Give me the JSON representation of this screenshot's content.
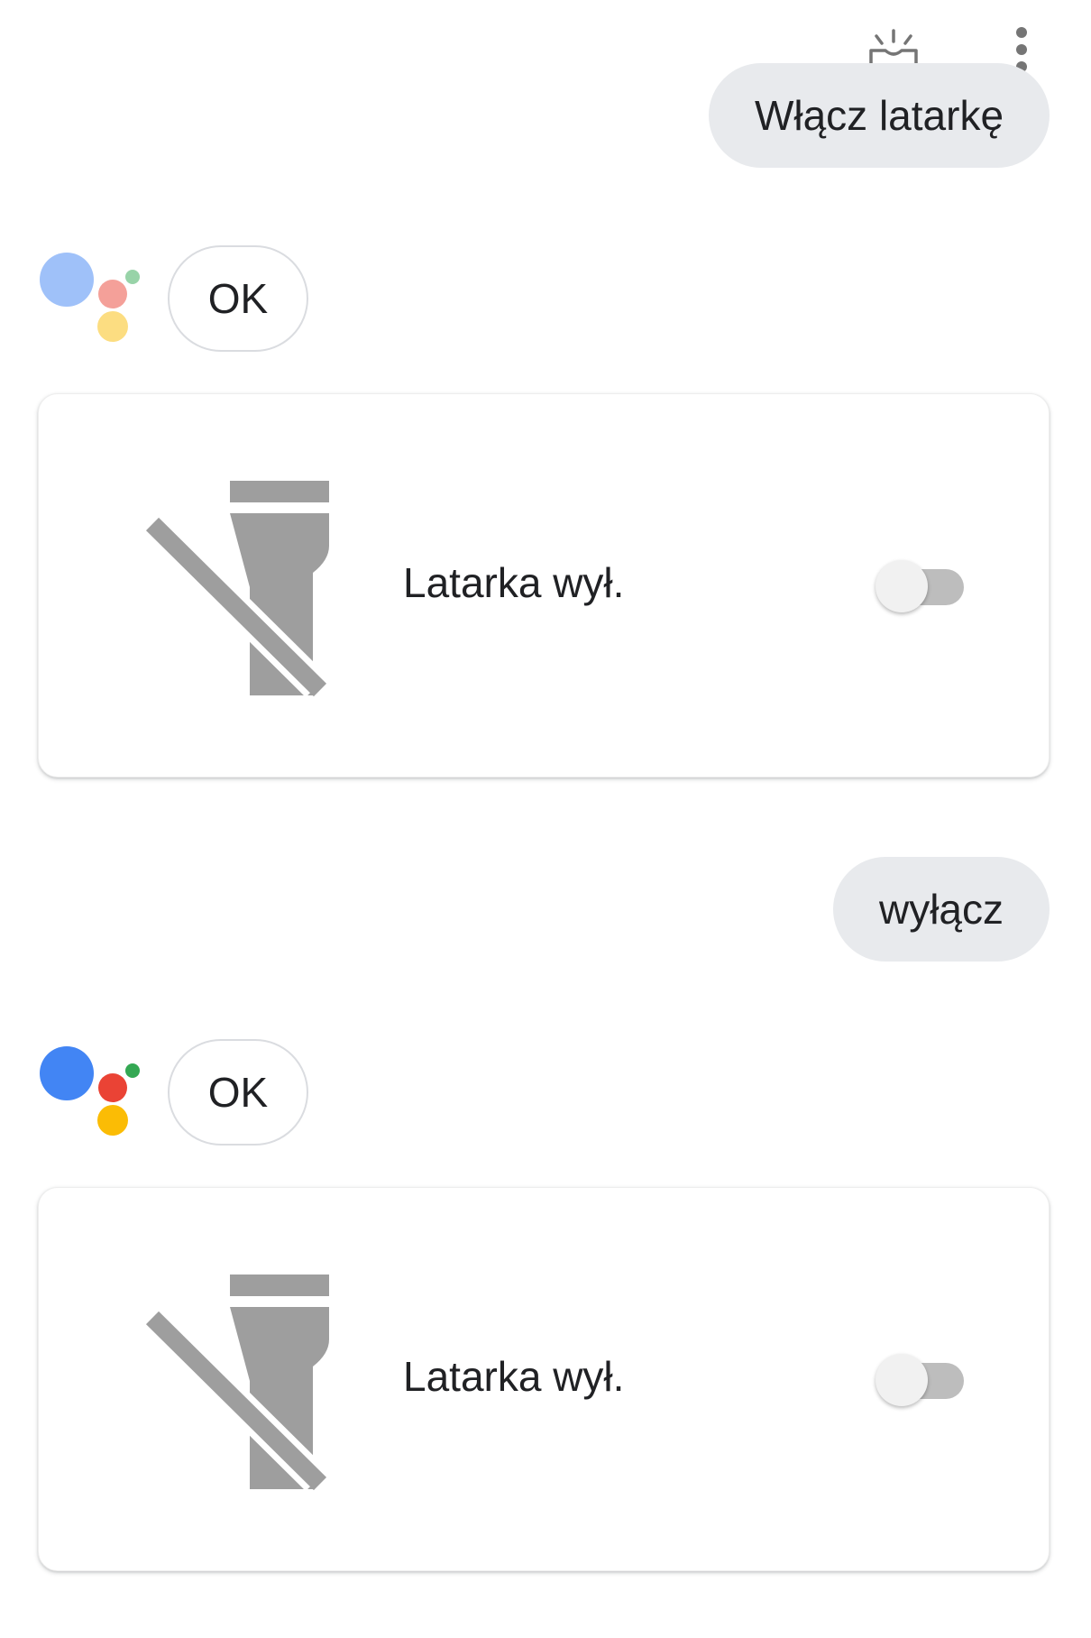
{
  "conversation": {
    "messages": [
      {
        "user": "Włącz latarkę",
        "assistant_reply": "OK",
        "card": {
          "label": "Latarka wył.",
          "icon": "flashlight-off-icon",
          "toggle_on": false
        },
        "logo_faded": true
      },
      {
        "user": "wyłącz",
        "assistant_reply": "OK",
        "card": {
          "label": "Latarka wył.",
          "icon": "flashlight-off-icon",
          "toggle_on": false
        },
        "logo_faded": false
      }
    ]
  },
  "toolbar": {
    "icons": [
      "inbox-updates-icon",
      "more-vert-icon"
    ]
  },
  "colors": {
    "bubble_bg": "#e8eaed",
    "icon_gray": "#9e9e9e",
    "assistant_blue": "#4285f4",
    "assistant_red": "#ea4335",
    "assistant_yellow": "#fbbc05",
    "assistant_green": "#34a853"
  }
}
